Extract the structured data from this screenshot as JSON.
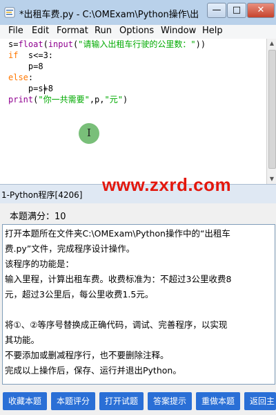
{
  "window": {
    "title": "*出租车费.py - C:\\OMExam\\Python操作\\出租..."
  },
  "menu": [
    "File",
    "Edit",
    "Format",
    "Run",
    "Options",
    "Window",
    "Help"
  ],
  "code": {
    "l1_a": "s=",
    "l1_b": "float",
    "l1_c": "(",
    "l1_d": "input",
    "l1_e": "(",
    "l1_f": "\"请输入出租车行驶的公里数：\"",
    "l1_g": "))",
    "l2_a": "if",
    "l2_b": "  s<=3:",
    "l3": "    p=8",
    "l4_a": "else",
    "l4_b": ":",
    "l5": "    p=s+8",
    "l6_a": "print",
    "l6_b": "(",
    "l6_c": "\"你一共需要\"",
    "l6_d": ",p,",
    "l6_e": "\"元\"",
    "l6_f": ")"
  },
  "shell": {
    "title": "1-Python程序[4206]"
  },
  "question": {
    "score": "本题满分：10",
    "lines": [
      "打开本题所在文件夹C:\\OMExam\\Python操作中的“出租车",
      "费.py”文件，完成程序设计操作。",
      "该程序的功能是：",
      "输入里程，计算出租车费。收费标准为：不超过3公里收费8",
      "元，超过3公里后，每公里收费1.5元。",
      "",
      "将①、②等序号替换成正确代码，调试、完善程序，以实现",
      "其功能。",
      "不要添加或删减程序行，也不要删除注释。",
      "完成以上操作后，保存、运行并退出Python。"
    ],
    "watermark": "www.zxrd.com"
  },
  "buttons": [
    "收藏本题",
    "本题评分",
    "打开试题",
    "答案提示",
    "重做本题",
    "返回主"
  ],
  "colors": {
    "keyword": "#ff7700",
    "builtin": "#900090",
    "string": "#00aa00",
    "button_bg": "#2a6fd6",
    "watermark": "#e3170d"
  }
}
